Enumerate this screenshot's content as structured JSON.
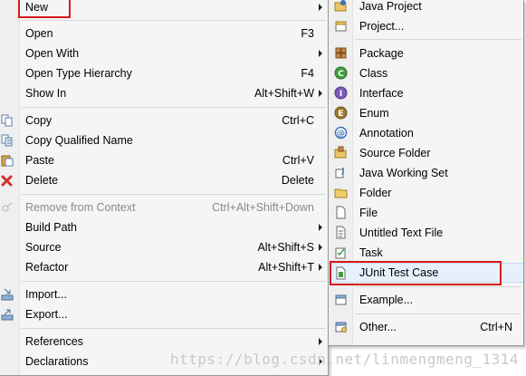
{
  "context_menu": {
    "items": [
      {
        "label": "New",
        "shortcut": "",
        "submenu": true
      },
      {
        "label": "Open",
        "shortcut": "F3"
      },
      {
        "label": "Open With",
        "shortcut": "",
        "submenu": true
      },
      {
        "label": "Open Type Hierarchy",
        "shortcut": "F4"
      },
      {
        "label": "Show In",
        "shortcut": "Alt+Shift+W",
        "submenu": true
      },
      {
        "label": "Copy",
        "shortcut": "Ctrl+C",
        "icon": "copy-icon"
      },
      {
        "label": "Copy Qualified Name",
        "shortcut": "",
        "icon": "copy-qualified-icon"
      },
      {
        "label": "Paste",
        "shortcut": "Ctrl+V",
        "icon": "paste-icon"
      },
      {
        "label": "Delete",
        "shortcut": "Delete",
        "icon": "delete-icon"
      },
      {
        "label": "Remove from Context",
        "shortcut": "Ctrl+Alt+Shift+Down",
        "disabled": true,
        "icon": "remove-context-icon"
      },
      {
        "label": "Build Path",
        "shortcut": "",
        "submenu": true
      },
      {
        "label": "Source",
        "shortcut": "Alt+Shift+S",
        "submenu": true
      },
      {
        "label": "Refactor",
        "shortcut": "Alt+Shift+T",
        "submenu": true
      },
      {
        "label": "Import...",
        "shortcut": "",
        "icon": "import-icon"
      },
      {
        "label": "Export...",
        "shortcut": "",
        "icon": "export-icon"
      },
      {
        "label": "References",
        "shortcut": "",
        "submenu": true
      },
      {
        "label": "Declarations",
        "shortcut": "",
        "submenu": true
      }
    ]
  },
  "new_submenu": {
    "items": [
      {
        "label": "Java Project",
        "icon": "java-project-icon"
      },
      {
        "label": "Project...",
        "icon": "project-icon"
      },
      {
        "label": "Package",
        "icon": "package-icon"
      },
      {
        "label": "Class",
        "icon": "class-icon"
      },
      {
        "label": "Interface",
        "icon": "interface-icon"
      },
      {
        "label": "Enum",
        "icon": "enum-icon"
      },
      {
        "label": "Annotation",
        "icon": "annotation-icon"
      },
      {
        "label": "Source Folder",
        "icon": "source-folder-icon"
      },
      {
        "label": "Java Working Set",
        "icon": "java-working-set-icon"
      },
      {
        "label": "Folder",
        "icon": "folder-icon"
      },
      {
        "label": "File",
        "icon": "file-icon"
      },
      {
        "label": "Untitled Text File",
        "icon": "untitled-text-file-icon"
      },
      {
        "label": "Task",
        "icon": "task-icon"
      },
      {
        "label": "JUnit Test Case",
        "icon": "junit-test-case-icon"
      },
      {
        "label": "Example...",
        "icon": "example-icon"
      },
      {
        "label": "Other...",
        "shortcut": "Ctrl+N",
        "icon": "other-icon"
      }
    ]
  },
  "watermark": "https://blog.csdn.net/linmengmeng_1314",
  "colors": {
    "highlight_box": "#d41b1b",
    "menu_bg": "#f5f5f5"
  }
}
